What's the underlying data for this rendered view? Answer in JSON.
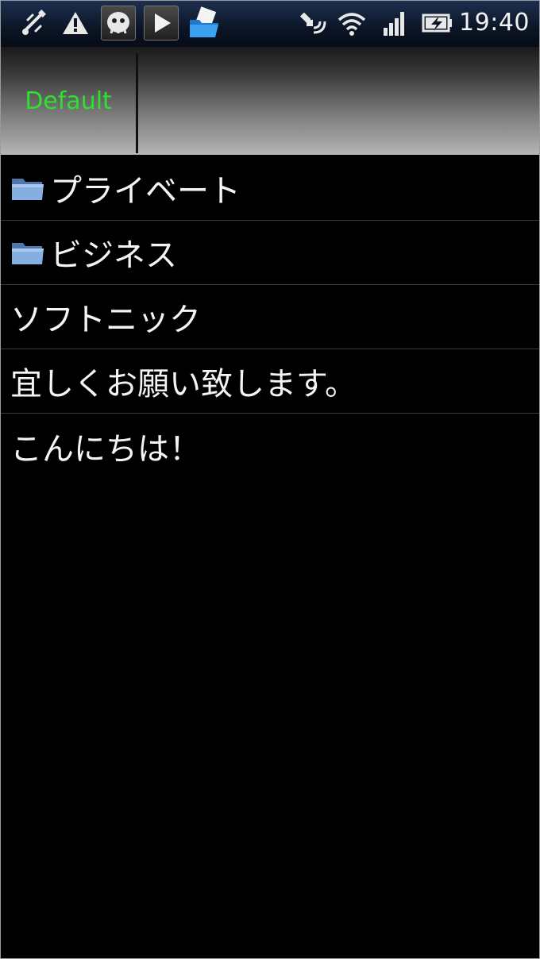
{
  "status_bar": {
    "icons": [
      "usb-debug-icon",
      "warning-icon",
      "app-notification-icon",
      "play-store-icon",
      "folder-notification-icon",
      "gps-icon",
      "wifi-icon",
      "signal-icon",
      "battery-charging-icon"
    ],
    "time": "19:40"
  },
  "tabs": [
    {
      "label": "Default",
      "color": "#2de12d"
    }
  ],
  "list": {
    "items": [
      {
        "label": "プライベート",
        "type": "folder"
      },
      {
        "label": "ビジネス",
        "type": "folder"
      },
      {
        "label": "ソフトニック",
        "type": "memo"
      },
      {
        "label": "宜しくお願い致します。",
        "type": "memo"
      },
      {
        "label": "こんにちは！",
        "type": "memo"
      }
    ]
  },
  "colors": {
    "background": "#000000",
    "tab_text": "#2de12d",
    "folder": "#7fa6d8"
  }
}
